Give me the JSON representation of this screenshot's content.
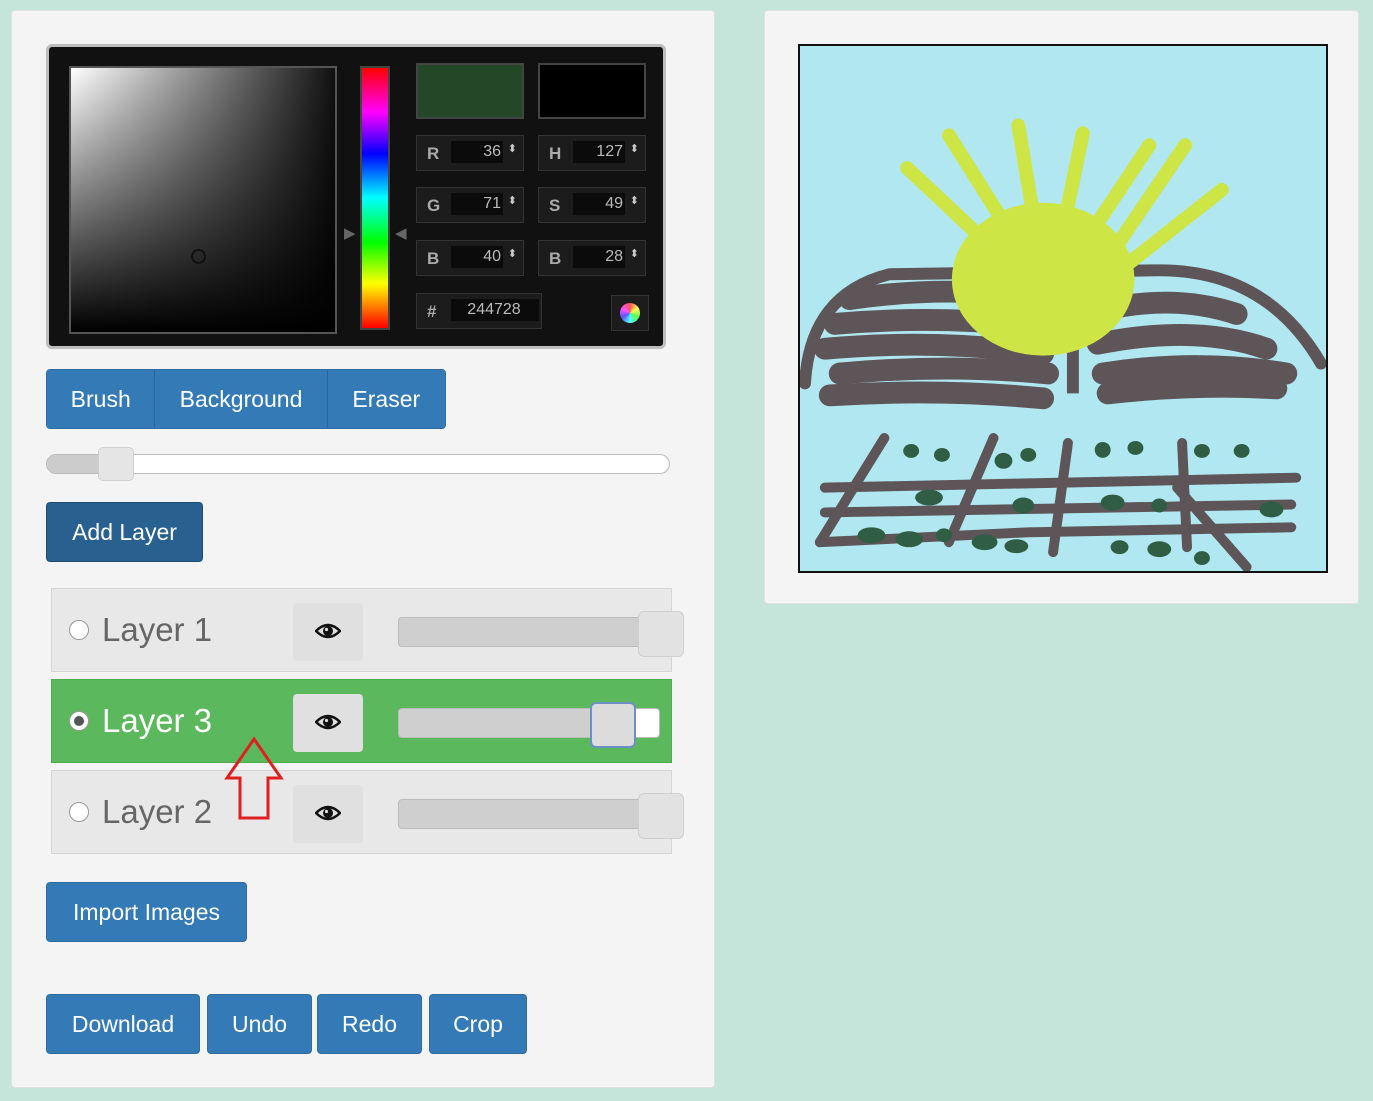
{
  "color_picker": {
    "new_color": "#244728",
    "current_color": "#000000",
    "fields": {
      "r": {
        "label": "R",
        "value": "36"
      },
      "g": {
        "label": "G",
        "value": "71"
      },
      "b": {
        "label": "B",
        "value": "40"
      },
      "h": {
        "label": "H",
        "value": "127"
      },
      "s": {
        "label": "S",
        "value": "49"
      },
      "bri": {
        "label": "B",
        "value": "28"
      },
      "hex": {
        "label": "#",
        "value": "244728"
      }
    },
    "spin_glyph": "⬍"
  },
  "modes": {
    "brush": "Brush",
    "background": "Background",
    "eraser": "Eraser",
    "active": "Brush"
  },
  "brush_size": {
    "value_fraction": 0.09
  },
  "buttons": {
    "add_layer": "Add Layer",
    "import_images": "Import Images",
    "download": "Download",
    "undo": "Undo",
    "redo": "Redo",
    "crop": "Crop"
  },
  "layers": [
    {
      "name": "Layer 1",
      "selected": false,
      "opacity_fraction": 1.0
    },
    {
      "name": "Layer 3",
      "selected": true,
      "opacity_fraction": 0.82
    },
    {
      "name": "Layer 2",
      "selected": false,
      "opacity_fraction": 1.0
    }
  ],
  "colors": {
    "primary_button": "#337ab7",
    "add_layer_button": "#286090",
    "active_layer": "#5cb85c",
    "page_background": "#c5e5da",
    "canvas_sky": "#b0e7f1",
    "sun": "#cde646",
    "fence": "#5d5558",
    "dots": "#2f5e45",
    "annotation_arrow": "#e02020"
  }
}
